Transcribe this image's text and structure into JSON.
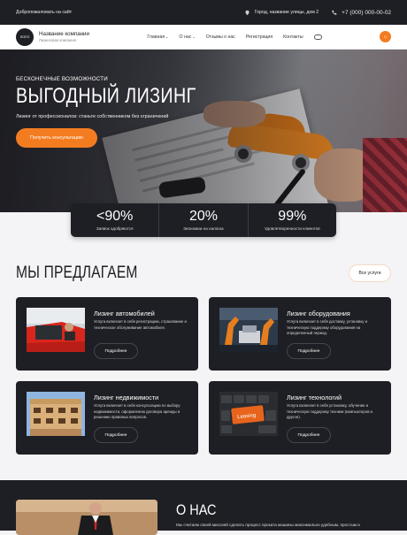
{
  "topbar": {
    "welcome": "Добропожаловать на сайт",
    "address": "Город, название улицы, дом 2",
    "phone": "+7 (000) 000-00-02"
  },
  "nav": {
    "logo": "ЛОГО",
    "company_name": "Название компании",
    "company_sub": "Лизинговая компания",
    "menu": [
      {
        "label": "Главная",
        "chevron": true
      },
      {
        "label": "О нас",
        "chevron": true
      },
      {
        "label": "Отзывы о нас",
        "chevron": false
      },
      {
        "label": "Регистрация",
        "chevron": false
      },
      {
        "label": "Контакты",
        "chevron": false
      }
    ],
    "cart_count": "0"
  },
  "hero": {
    "eyebrow": "БЕСКОНЕЧНЫЕ ВОЗМОЖНОСТИ",
    "title": "ВЫГОДНЫЙ ЛИЗИНГ",
    "subtitle": "Лизинг от профессионалов: станьте собственником без ограничений",
    "cta": "Получить консультацию"
  },
  "stats": [
    {
      "value": "<90%",
      "label": "Заявок одобряются"
    },
    {
      "value": "20%",
      "label": "Экономии на налогах"
    },
    {
      "value": "99%",
      "label": "Удовлетворенности клиентов"
    }
  ],
  "offer": {
    "title": "МЫ ПРЕДЛАГАЕМ",
    "all_button": "Все услуги",
    "cards": [
      {
        "title": "Лизинг автомобилей",
        "text": "Услуга включает в себя регистрацию, страхование и техническое обслуживание автомобиля.",
        "button": "Подробнее"
      },
      {
        "title": "Лизинг оборудования",
        "text": "Услуга включает в себя доставку, установку и техническую поддержку оборудования на определенный период.",
        "button": "Подробнее"
      },
      {
        "title": "Лизинг недвижимости",
        "text": "Услуга включает в себя консультацию по выбору недвижимости, оформлению договора аренды и решению правовых вопросов.",
        "button": "Подробнее"
      },
      {
        "title": "Лизинг технологий",
        "text": "Услуга включает в себя установку, обучение и техническую поддержку техники (компьютеров и другое).",
        "button": "Подробнее"
      }
    ]
  },
  "about": {
    "title": "О НАС",
    "text": "Мы считаем своей миссией сделать процесс проката машины максимально удобным, простым и"
  },
  "colors": {
    "accent": "#f47c20",
    "dark": "#1e1f24",
    "background": "#f4f4f6"
  }
}
